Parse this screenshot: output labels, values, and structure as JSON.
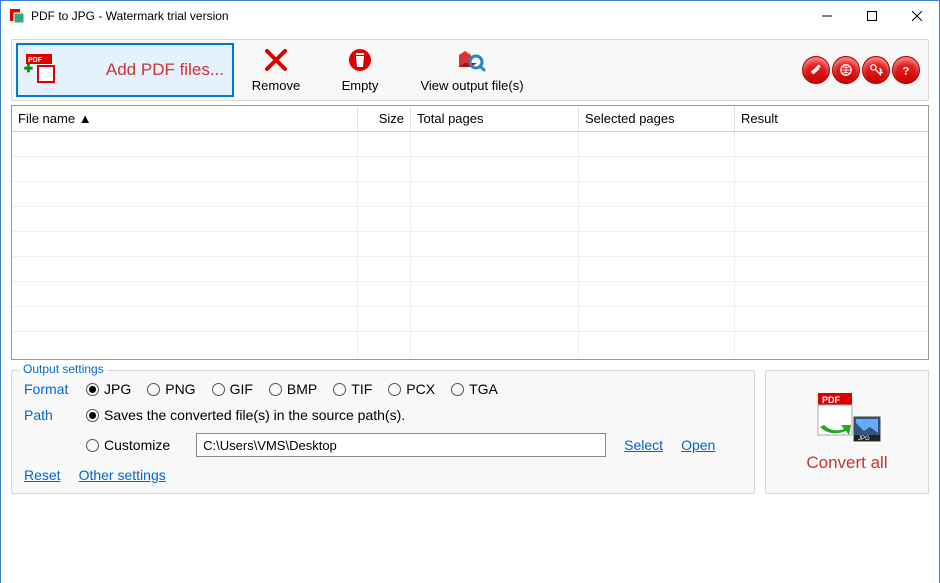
{
  "title": "PDF to JPG - Watermark trial version",
  "toolbar": {
    "add": "Add PDF files...",
    "remove": "Remove",
    "empty": "Empty",
    "view": "View output file(s)"
  },
  "grid": {
    "headers": {
      "filename": "File name ▲",
      "size": "Size",
      "totalpages": "Total pages",
      "selectedpages": "Selected pages",
      "result": "Result"
    }
  },
  "output": {
    "legend": "Output settings",
    "format_label": "Format",
    "formats": [
      "JPG",
      "PNG",
      "GIF",
      "BMP",
      "TIF",
      "PCX",
      "TGA"
    ],
    "format_selected": "JPG",
    "path_label": "Path",
    "save_source": "Saves the converted file(s) in the source path(s).",
    "customize": "Customize",
    "custom_path": "C:\\Users\\VMS\\Desktop",
    "path_mode": "source",
    "select": "Select",
    "open": "Open",
    "reset": "Reset",
    "other": "Other settings"
  },
  "convert": "Convert all"
}
